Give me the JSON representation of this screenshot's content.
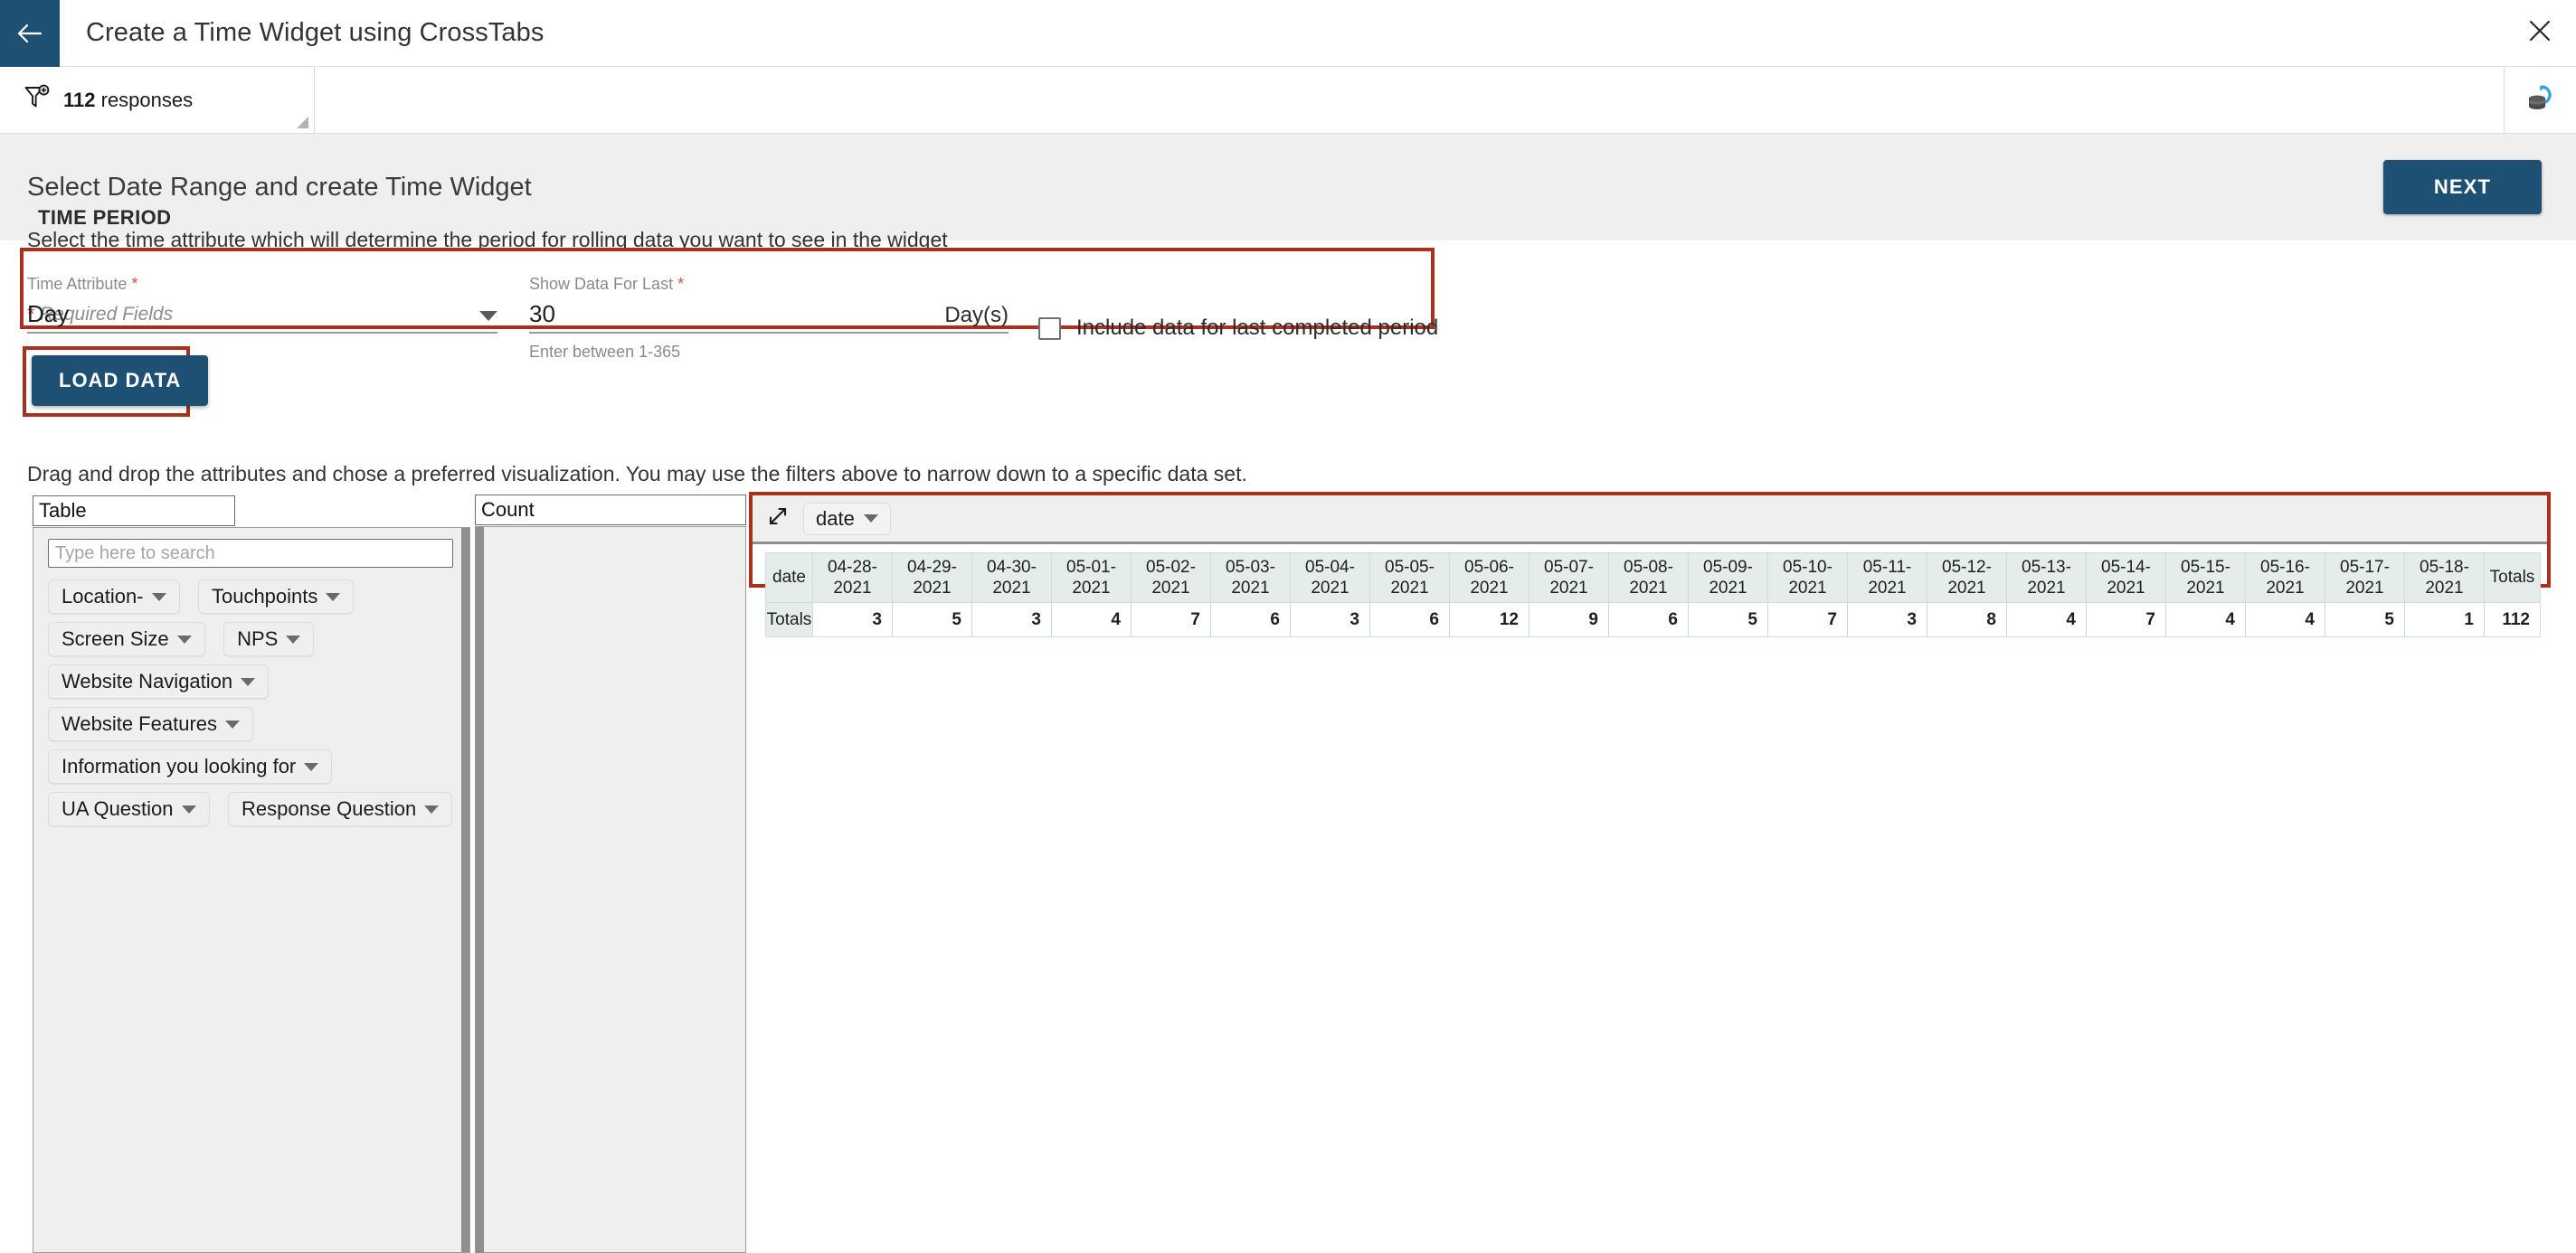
{
  "topbar": {
    "back_icon": "arrow-left-icon",
    "title": "Create a Time Widget using CrossTabs",
    "close_icon": "close-icon"
  },
  "filterbar": {
    "filter_icon": "filter-add-icon",
    "count": "112",
    "count_suffix": " responses",
    "database_icon": "database-refresh-icon"
  },
  "section": {
    "heading": "Select Date Range and create Time Widget",
    "next_label": "NEXT"
  },
  "form": {
    "required_star": "*",
    "required_note": " Required Fields",
    "time_period_label": "TIME PERIOD",
    "time_period_help": "Select the time attribute which will determine the period for rolling data you want to see in the widget",
    "time_attribute": {
      "label": "Time Attribute ",
      "star": "*",
      "value": "Day"
    },
    "show_data_for_last": {
      "label": "Show Data For Last ",
      "star": "*",
      "value": "30",
      "suffix": "Day(s)",
      "hint": "Enter between 1-365"
    },
    "include_last_period": {
      "label": "Include data for last completed period",
      "checked": false
    },
    "load_data_label": "LOAD DATA",
    "drag_drop_help": "Drag and drop the attributes and chose a preferred visualization. You may use the filters above to narrow down to a specific data set."
  },
  "builder": {
    "table_pane_title": "Table",
    "count_pane_title": "Count",
    "search_placeholder": "Type here to search",
    "attributes": [
      {
        "label": "Location-"
      },
      {
        "label": "Touchpoints"
      },
      {
        "label": "Screen Size"
      },
      {
        "label": "NPS"
      },
      {
        "label": "Website Navigation"
      },
      {
        "label": "Website Features"
      },
      {
        "label": "Information you looking for"
      },
      {
        "label": "UA Question"
      },
      {
        "label": "Response Question"
      }
    ],
    "expand_icon": "expand-diagonal-icon",
    "column_chip": "date"
  },
  "chart_data": {
    "type": "table",
    "title": "date",
    "row_header": "date",
    "row_label": "Totals",
    "totals_header": "Totals",
    "categories": [
      "04-28-2021",
      "04-29-2021",
      "04-30-2021",
      "05-01-2021",
      "05-02-2021",
      "05-03-2021",
      "05-04-2021",
      "05-05-2021",
      "05-06-2021",
      "05-07-2021",
      "05-08-2021",
      "05-09-2021",
      "05-10-2021",
      "05-11-2021",
      "05-12-2021",
      "05-13-2021",
      "05-14-2021",
      "05-15-2021",
      "05-16-2021",
      "05-17-2021",
      "05-18-2021"
    ],
    "values": [
      3,
      5,
      3,
      4,
      7,
      6,
      3,
      6,
      12,
      9,
      6,
      5,
      7,
      3,
      8,
      4,
      7,
      4,
      4,
      5,
      1
    ],
    "total": 112,
    "xlabel": "date",
    "ylabel": "Count"
  },
  "colors": {
    "brand_navy": "#1d5073",
    "highlight_red": "#a92f1e",
    "required_red": "#d93025",
    "header_gray": "#efefef",
    "table_header": "#e4edeb"
  }
}
